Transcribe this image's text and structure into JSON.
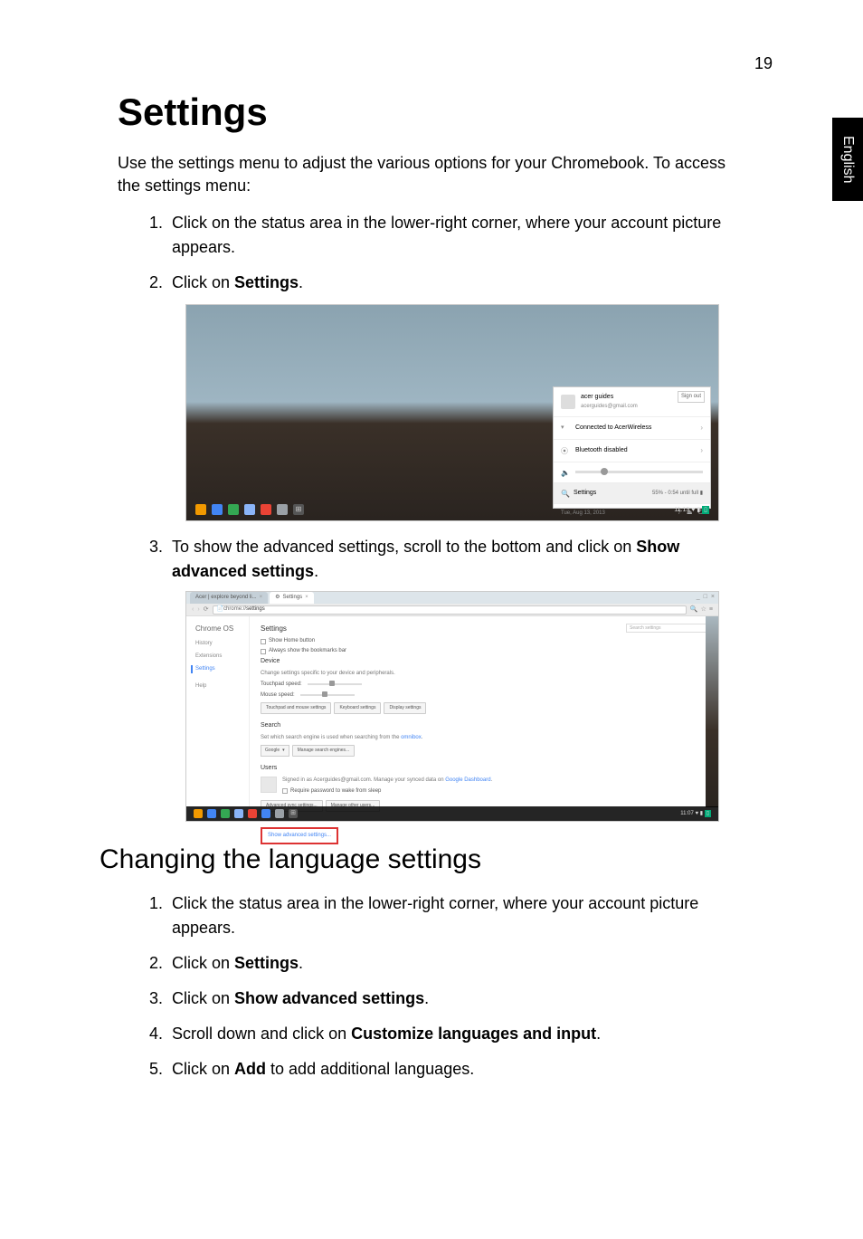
{
  "page_number": "19",
  "language_tab": "English",
  "title": "Settings",
  "intro": "Use the settings menu to adjust the various options for your Chromebook. To access the settings menu:",
  "steps_main": [
    {
      "pre": "Click on the status area in the lower-right corner, where your account picture appears.",
      "bold": ""
    },
    {
      "pre": "Click on ",
      "bold": "Settings",
      "post": "."
    },
    {
      "pre": "To show the advanced settings, scroll to the bottom and click on ",
      "bold": "Show advanced settings",
      "post": "."
    }
  ],
  "subtitle": "Changing the language settings",
  "steps_lang": [
    {
      "pre": "Click the status area in the lower-right corner, where your account picture appears.",
      "bold": ""
    },
    {
      "pre": "Click on ",
      "bold": "Settings",
      "post": "."
    },
    {
      "pre": "Click on ",
      "bold": "Show advanced settings",
      "post": "."
    },
    {
      "pre": "Scroll down and click on ",
      "bold": "Customize languages and input",
      "post": "."
    },
    {
      "pre": "Click on ",
      "bold": "Add",
      "post": " to add additional languages."
    }
  ],
  "ss1": {
    "user_name": "acer guides",
    "user_email": "acerguides@gmail.com",
    "signout": "Sign out",
    "wifi": "Connected to AcerWireless",
    "bluetooth": "Bluetooth disabled",
    "settings_label": "Settings",
    "battery": "55% - 0:54 until full",
    "date": "Tue, Aug 13, 2013",
    "time": "11:13",
    "taskbar_colors": [
      "#f29900",
      "#4285f4",
      "#34a853",
      "#8ab4f8",
      "#ea4335",
      "#9aa0a6"
    ]
  },
  "ss2": {
    "tab1": "Acer | explore beyond li...",
    "tab2_icon": "⚙",
    "tab2": "Settings",
    "url_prefix": "chrome://",
    "url_bold": "settings",
    "sidebar_title": "Chrome OS",
    "sidebar": [
      "History",
      "Extensions",
      "Settings",
      "Help"
    ],
    "main_title": "Settings",
    "search_placeholder": "Search settings",
    "row1": "Show Home button",
    "row2": "Always show the bookmarks bar",
    "device_title": "Device",
    "device_desc": "Change settings specific to your device and peripherals.",
    "touchpad": "Touchpad speed:",
    "mouse": "Mouse speed:",
    "btn_touchpad": "Touchpad and mouse settings",
    "btn_keyboard": "Keyboard settings",
    "btn_display": "Display settings",
    "search_title": "Search",
    "search_desc_pre": "Set which search engine is used when searching from the ",
    "search_desc_link": "omnibox",
    "search_select": "Google",
    "btn_manage_search": "Manage search engines...",
    "users_title": "Users",
    "users_signed_pre": "Signed in as Acerguides@gmail.com. Manage your synced data on ",
    "users_signed_link": "Google Dashboard",
    "users_require": "Require password to wake from sleep",
    "btn_sync": "Advanced sync settings...",
    "btn_manage_users": "Manage other users...",
    "show_advanced": "Show advanced settings...",
    "time": "11:07",
    "taskbar_colors": [
      "#f29900",
      "#4285f4",
      "#34a853",
      "#8ab4f8",
      "#ea4335",
      "#4285f4",
      "#9aa0a6"
    ]
  }
}
